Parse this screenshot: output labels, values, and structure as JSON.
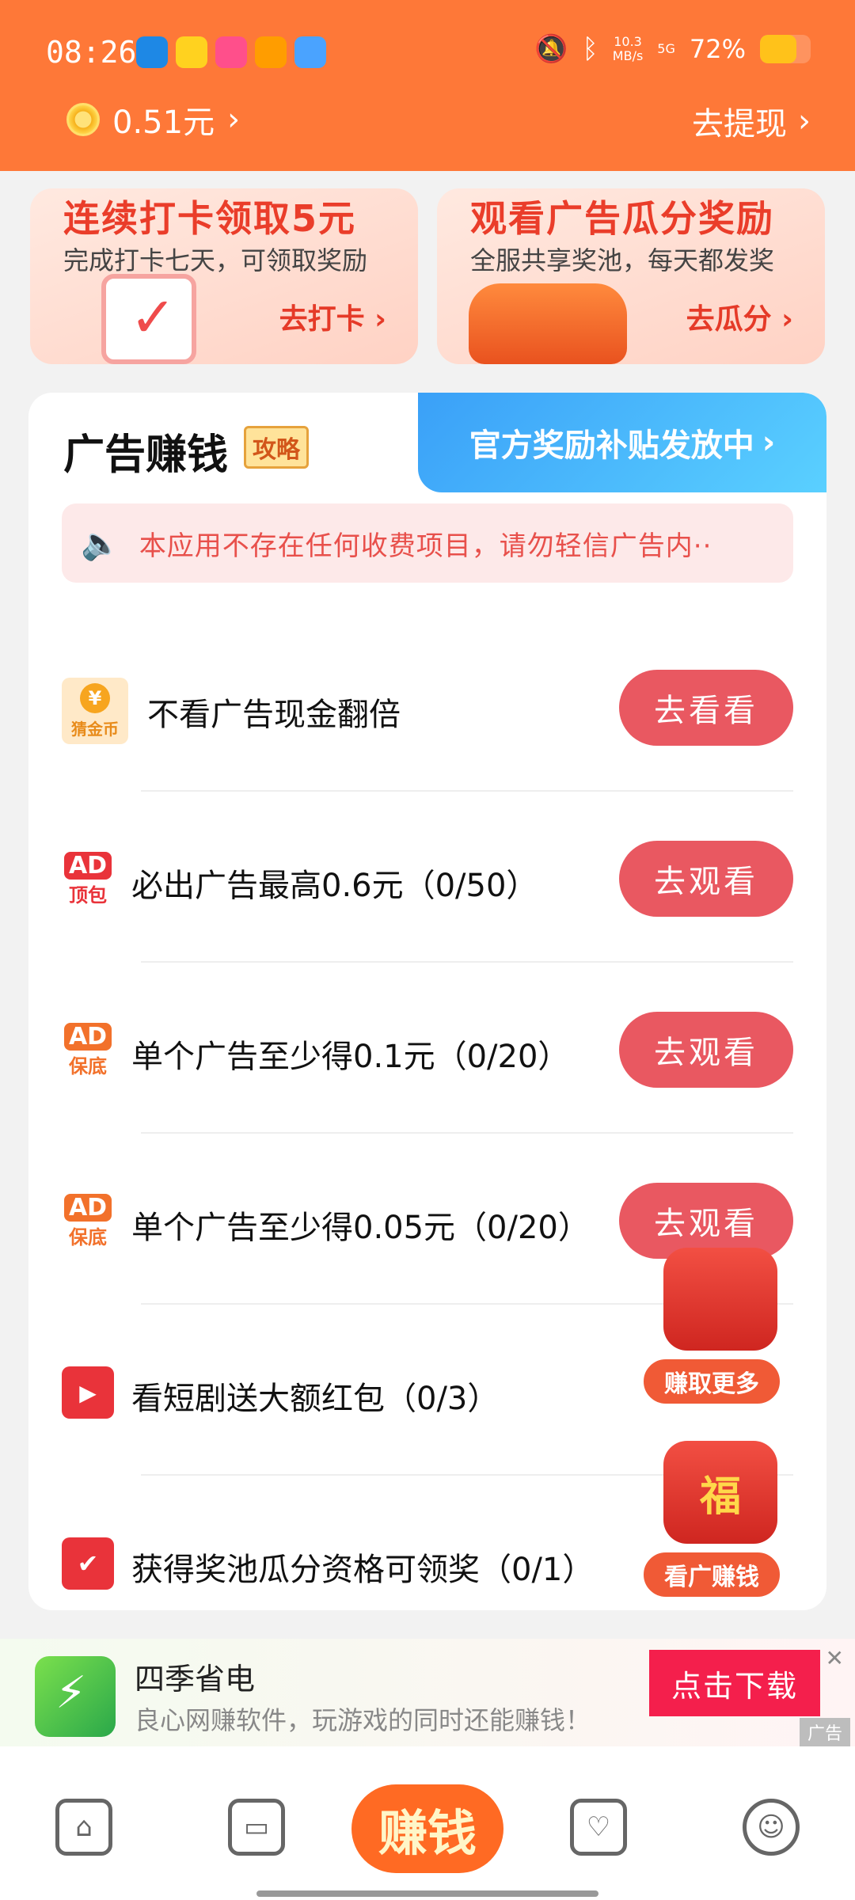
{
  "status_bar": {
    "time": "08:26",
    "network_speed": "10.3",
    "network_unit": "MB/s",
    "signal": "5G",
    "battery_percent": "72%",
    "battery_level": 0.72
  },
  "header": {
    "balance": "0.51元",
    "withdraw_label": "去提现"
  },
  "promo_cards": [
    {
      "title": "连续打卡领取5元",
      "subtitle": "完成打卡七天，可领取奖励",
      "button": "去打卡"
    },
    {
      "title": "观看广告瓜分奖励",
      "subtitle": "全服共享奖池，每天都发奖",
      "button": "去瓜分"
    }
  ],
  "section": {
    "title": "广告赚钱",
    "guide_tag": "攻略",
    "banner_text": "官方奖励补贴发放中"
  },
  "notice": {
    "text": "本应用不存在任何收费项目，请勿轻信广告内··"
  },
  "tasks": [
    {
      "icon_text": "猜金币",
      "icon_symbol": "¥",
      "label": "不看广告现金翻倍",
      "button": "去看看"
    },
    {
      "icon_text": "AD",
      "icon_sub": "顶包",
      "label": "必出广告最高0.6元（0/50）",
      "button": "去观看"
    },
    {
      "icon_text": "AD",
      "icon_sub": "保底",
      "label": "单个广告至少得0.1元（0/20）",
      "button": "去观看"
    },
    {
      "icon_text": "AD",
      "icon_sub": "保底",
      "label": "单个广告至少得0.05元（0/20）",
      "button": "去观看"
    },
    {
      "label": "看短剧送大额红包（0/3）"
    },
    {
      "label": "获得奖池瓜分资格可领奖（0/1）"
    }
  ],
  "floating_promos": [
    {
      "tag": "赚取更多"
    },
    {
      "tag": "看广赚钱",
      "pic_char": "福"
    }
  ],
  "ad_banner": {
    "app_name": "四季省电",
    "description": "良心网赚软件，玩游戏的同时还能赚钱！",
    "download_button": "点击下载",
    "ad_tag": "广告"
  },
  "bottom_nav": {
    "center_label": "赚钱"
  }
}
